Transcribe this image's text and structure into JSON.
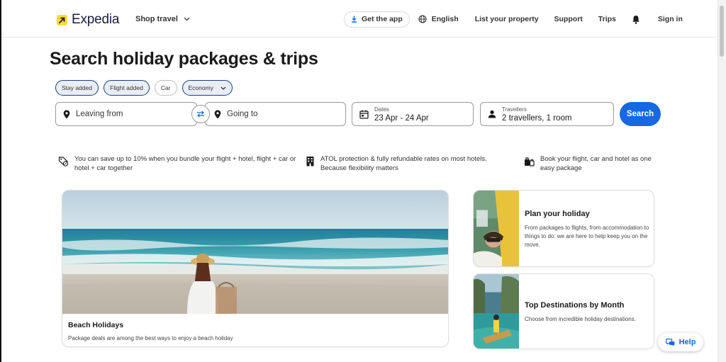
{
  "header": {
    "logo_text": "Expedia",
    "shop_travel": "Shop travel",
    "get_app": "Get the app",
    "language": "English",
    "list_property": "List your property",
    "support": "Support",
    "trips": "Trips",
    "sign_in": "Sign in"
  },
  "page_title": "Search holiday packages & trips",
  "chips": {
    "stay": "Stay added",
    "flight": "Flight added",
    "car": "Car",
    "cabin_class": "Economy"
  },
  "search": {
    "leaving_placeholder": "Leaving from",
    "going_placeholder": "Going to",
    "dates_label": "Dates",
    "dates_value": "23 Apr - 24 Apr",
    "travellers_label": "Travellers",
    "travellers_value": "2 travellers, 1 room",
    "search_button": "Search"
  },
  "benefits": [
    {
      "text": "You can save up to 10% when you bundle your flight + hotel, flight + car or hotel + car together",
      "icon": "tag-percent-icon"
    },
    {
      "text": "ATOL protection & fully refundable rates on most hotels. Because flexibility matters",
      "icon": "building-icon"
    },
    {
      "text": "Book your flight, car and hotel as one easy package",
      "icon": "luggage-icon"
    }
  ],
  "hero": {
    "title": "Beach Holidays",
    "description": "Package deals are among the best ways to enjoy a beach holiday"
  },
  "cards": [
    {
      "title": "Plan your holiday",
      "description": "From packages to flights, from accommodation to things to do: we are here to help keep you on the move."
    },
    {
      "title": "Top Destinations by Month",
      "description": "Choose from incredible holiday destinations."
    }
  ],
  "help": "Help",
  "colors": {
    "brand_yellow": "#fddb32",
    "brand_navy": "#191e3b",
    "primary_blue": "#1668e3",
    "chip_selected_border": "#1c3e7a"
  }
}
